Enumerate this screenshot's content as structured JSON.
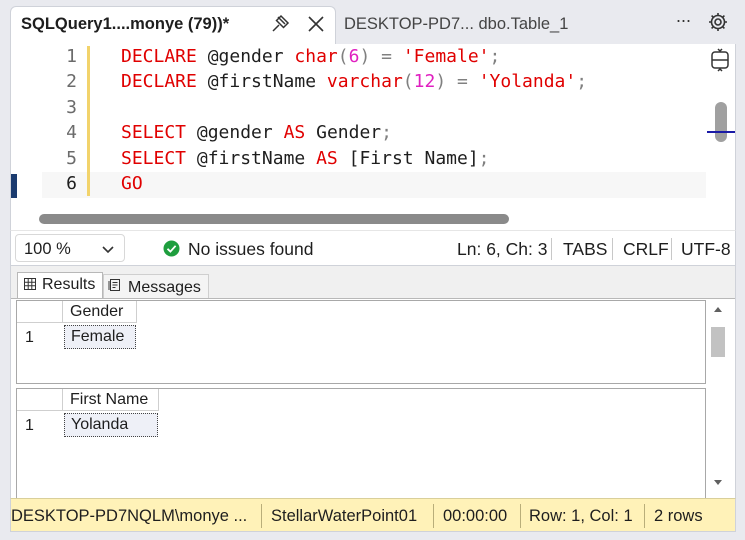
{
  "tabs": [
    {
      "title": "SQLQuery1....monye (79))*",
      "active": true
    },
    {
      "title": "DESKTOP-PD7... dbo.Table_1",
      "active": false
    }
  ],
  "tab_actions": {
    "more": "···"
  },
  "editor": {
    "line_numbers": [
      "1",
      "2",
      "3",
      "4",
      "5",
      "6"
    ],
    "current_line": 6,
    "lines": [
      {
        "tokens": [
          {
            "t": "DECLARE",
            "c": "kw"
          },
          {
            "t": " ",
            "c": "id"
          },
          {
            "t": "@gender",
            "c": "id"
          },
          {
            "t": " ",
            "c": "id"
          },
          {
            "t": "char",
            "c": "kw"
          },
          {
            "t": "(",
            "c": "punc"
          },
          {
            "t": "6",
            "c": "num"
          },
          {
            "t": ")",
            "c": "punc"
          },
          {
            "t": " ",
            "c": "id"
          },
          {
            "t": "=",
            "c": "punc"
          },
          {
            "t": " ",
            "c": "id"
          },
          {
            "t": "'Female'",
            "c": "str"
          },
          {
            "t": ";",
            "c": "punc"
          }
        ]
      },
      {
        "tokens": [
          {
            "t": "DECLARE",
            "c": "kw"
          },
          {
            "t": " ",
            "c": "id"
          },
          {
            "t": "@firstName",
            "c": "id"
          },
          {
            "t": " ",
            "c": "id"
          },
          {
            "t": "varchar",
            "c": "kw"
          },
          {
            "t": "(",
            "c": "punc"
          },
          {
            "t": "12",
            "c": "num"
          },
          {
            "t": ")",
            "c": "punc"
          },
          {
            "t": " ",
            "c": "id"
          },
          {
            "t": "=",
            "c": "punc"
          },
          {
            "t": " ",
            "c": "id"
          },
          {
            "t": "'Yolanda'",
            "c": "str"
          },
          {
            "t": ";",
            "c": "punc"
          }
        ]
      },
      {
        "tokens": []
      },
      {
        "tokens": [
          {
            "t": "SELECT",
            "c": "kw"
          },
          {
            "t": " ",
            "c": "id"
          },
          {
            "t": "@gender",
            "c": "id"
          },
          {
            "t": " ",
            "c": "id"
          },
          {
            "t": "AS",
            "c": "kw"
          },
          {
            "t": " ",
            "c": "id"
          },
          {
            "t": "Gender",
            "c": "id"
          },
          {
            "t": ";",
            "c": "punc"
          }
        ]
      },
      {
        "tokens": [
          {
            "t": "SELECT",
            "c": "kw"
          },
          {
            "t": " ",
            "c": "id"
          },
          {
            "t": "@firstName",
            "c": "id"
          },
          {
            "t": " ",
            "c": "id"
          },
          {
            "t": "AS",
            "c": "kw"
          },
          {
            "t": " ",
            "c": "id"
          },
          {
            "t": "[First Name]",
            "c": "id"
          },
          {
            "t": ";",
            "c": "punc"
          }
        ]
      },
      {
        "tokens": [
          {
            "t": "GO",
            "c": "kw"
          }
        ]
      }
    ]
  },
  "editor_status": {
    "zoom": "100 %",
    "issues": "No issues found",
    "position": "Ln: 6, Ch: 3",
    "indent": "TABS",
    "line_ending": "CRLF",
    "encoding": "UTF-8"
  },
  "results_tabs": {
    "results": "Results",
    "messages": "Messages"
  },
  "result_grids": [
    {
      "column": "Gender",
      "row_number": "1",
      "value": "Female"
    },
    {
      "column": "First Name",
      "row_number": "1",
      "value": "Yolanda"
    }
  ],
  "status_bar": {
    "server": "DESKTOP-PD7NQLM\\monye ...",
    "database": "StellarWaterPoint01",
    "elapsed": "00:00:00",
    "cursor": "Row: 1, Col: 1",
    "rows": "2 rows"
  },
  "colors": {
    "keyword": "#e00000",
    "number": "#e020c0",
    "status_bar_bg": "#fff2b8",
    "success": "#1e9e3e"
  }
}
